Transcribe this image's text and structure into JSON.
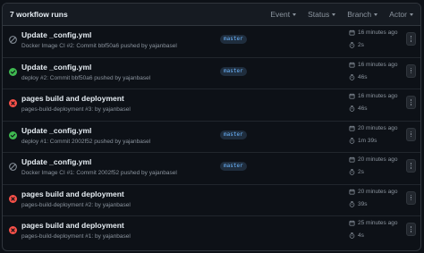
{
  "header": {
    "run_count": "7 workflow runs",
    "filters": [
      "Event",
      "Status",
      "Branch",
      "Actor"
    ]
  },
  "colors": {
    "success": "#3fb950",
    "failure": "#f85149",
    "skipped": "#8b949e",
    "branch_text": "#6cb6ff"
  },
  "runs": [
    {
      "status": "skipped",
      "title": "Update _config.yml",
      "subtitle": "Docker Image CI #2: Commit bbf50a6 pushed by yajanbasel",
      "branch": "master",
      "time": "16 minutes ago",
      "duration": "2s"
    },
    {
      "status": "success",
      "title": "Update _config.yml",
      "subtitle": "deploy #2: Commit bbf50a6 pushed by yajanbasel",
      "branch": "master",
      "time": "16 minutes ago",
      "duration": "46s"
    },
    {
      "status": "failure",
      "title": "pages build and deployment",
      "subtitle": "pages-build-deployment #3: by yajanbasel",
      "branch": "",
      "time": "16 minutes ago",
      "duration": "46s"
    },
    {
      "status": "success",
      "title": "Update _config.yml",
      "subtitle": "deploy #1: Commit 2002f52 pushed by yajanbasel",
      "branch": "master",
      "time": "20 minutes ago",
      "duration": "1m 39s"
    },
    {
      "status": "skipped",
      "title": "Update _config.yml",
      "subtitle": "Docker Image CI #1: Commit 2002f52 pushed by yajanbasel",
      "branch": "master",
      "time": "20 minutes ago",
      "duration": "2s"
    },
    {
      "status": "failure",
      "title": "pages build and deployment",
      "subtitle": "pages-build-deployment #2: by yajanbasel",
      "branch": "",
      "time": "20 minutes ago",
      "duration": "39s"
    },
    {
      "status": "failure",
      "title": "pages build and deployment",
      "subtitle": "pages-build-deployment #1: by yajanbasel",
      "branch": "",
      "time": "25 minutes ago",
      "duration": "4s"
    }
  ]
}
